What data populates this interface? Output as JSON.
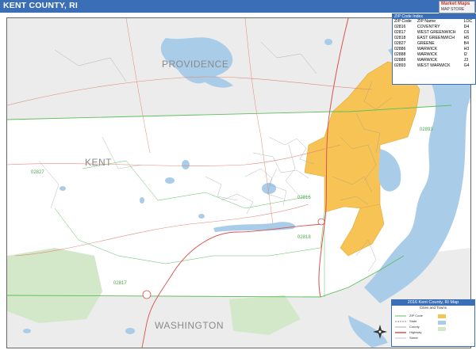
{
  "title": "KENT COUNTY, RI",
  "colors": {
    "title_bar": "#3a6fb8",
    "water": "#a9cde9",
    "land": "#ffffff",
    "outside": "#e8e8e8",
    "highlight": "#f7c354",
    "park": "#cfe6c6",
    "zip_line": "#5cbf5c",
    "road_main": "#d9534f"
  },
  "logo": {
    "line1": "Market Maps",
    "line2": "MAP STORE"
  },
  "region_labels": [
    {
      "id": "providence",
      "text": "PROVIDENCE"
    },
    {
      "id": "kent",
      "text": "KENT"
    },
    {
      "id": "washington",
      "text": "WASHINGTON"
    }
  ],
  "zip_labels": [
    "02827",
    "02893",
    "02816",
    "02817",
    "02818",
    "02889"
  ],
  "zip_table": {
    "header": "ZIP Code Index",
    "columns": [
      "ZIP Code",
      "ZIP Name",
      "LOC"
    ],
    "rows": [
      [
        "02816",
        "COVENTRY",
        "D4"
      ],
      [
        "02817",
        "WEST GREENWICH",
        "C6"
      ],
      [
        "02818",
        "EAST GREENWICH",
        "H5"
      ],
      [
        "02827",
        "GREENE",
        "B4"
      ],
      [
        "02886",
        "WARWICK",
        "H3"
      ],
      [
        "02888",
        "WARWICK",
        "I2"
      ],
      [
        "02889",
        "WARWICK",
        "J3"
      ],
      [
        "02893",
        "WEST WARWICK",
        "G4"
      ]
    ]
  },
  "legend": {
    "title": "2016 Kent County, RI Map",
    "subtitle": "Cities and Towns",
    "items": [
      "ZIP Code",
      "State",
      "County",
      "Highway",
      "Street"
    ]
  }
}
